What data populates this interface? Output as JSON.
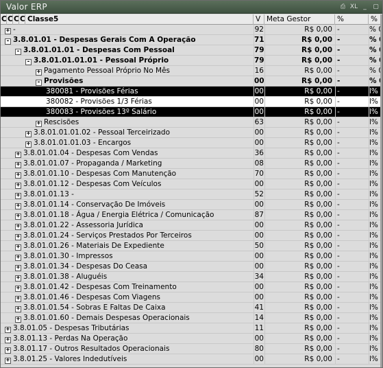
{
  "window": {
    "title": "Valor ERP",
    "buttons": [
      "⎙",
      "XL",
      "_",
      "▢"
    ]
  },
  "headers": {
    "cl1": "Cl",
    "cl2": "Cl",
    "cl3": "Cl",
    "cl4": "Cl",
    "classe5": "Classe5",
    "v": "V",
    "meta": "Meta Gestor",
    "p1": "%",
    "p2": "%"
  },
  "rows": [
    {
      "level": 0,
      "exp": "+",
      "label": "-",
      "v": "92",
      "meta": "R$ 0,00",
      "p1": "-",
      "p2": "% 0",
      "style": ""
    },
    {
      "level": 0,
      "exp": "-",
      "label": "3.8.01.01 - Despesas Gerais Com A Operação",
      "v": "71",
      "meta": "R$ 0,00",
      "p1": "-",
      "p2": "% 0",
      "style": "bold"
    },
    {
      "level": 1,
      "exp": "-",
      "label": "3.8.01.01.01 - Despesas Com Pessoal",
      "v": "79",
      "meta": "R$ 0,00",
      "p1": "-",
      "p2": "% 0",
      "style": "bold"
    },
    {
      "level": 2,
      "exp": "-",
      "label": "3.8.01.01.01.01 - Pessoal Próprio",
      "v": "79",
      "meta": "R$ 0,00",
      "p1": "-",
      "p2": "% 0",
      "style": "bold"
    },
    {
      "level": 3,
      "exp": "+",
      "label": "Pagamento Pessoal Próprio No Mês",
      "v": "16",
      "meta": "R$ 0,00",
      "p1": "-",
      "p2": "% 0",
      "style": ""
    },
    {
      "level": 3,
      "exp": "-",
      "label": "Provisões",
      "v": "00",
      "meta": "R$ 0,00",
      "p1": "-",
      "p2": "% 0",
      "style": "bold"
    },
    {
      "level": 4,
      "exp": "",
      "label": "380081 - Provisões Férias",
      "v": "00",
      "meta": "R$ 0,00",
      "p1": "-",
      "p2": "l% 0",
      "style": "sel"
    },
    {
      "level": 4,
      "exp": "",
      "label": "380082 - Provisões  1/3  Férias",
      "v": "00",
      "meta": "R$ 0,00",
      "p1": "-",
      "p2": "l% 0",
      "style": "selpart"
    },
    {
      "level": 4,
      "exp": "",
      "label": "380083 - Provisões 13º Salário",
      "v": "00",
      "meta": "R$ 0,00",
      "p1": "-",
      "p2": "l% 0",
      "style": "sel"
    },
    {
      "level": 3,
      "exp": "+",
      "label": "Rescisões",
      "v": "63",
      "meta": "R$ 0,00",
      "p1": "-",
      "p2": "l% 0",
      "style": ""
    },
    {
      "level": 2,
      "exp": "+",
      "label": "3.8.01.01.01.02 - Pessoal Terceirizado",
      "v": "00",
      "meta": "R$ 0,00",
      "p1": "-",
      "p2": "l% 0",
      "style": ""
    },
    {
      "level": 2,
      "exp": "+",
      "label": "3.8.01.01.01.03 - Encargos",
      "v": "00",
      "meta": "R$ 0,00",
      "p1": "-",
      "p2": "l% 0",
      "style": ""
    },
    {
      "level": 1,
      "exp": "+",
      "label": "3.8.01.01.04 - Despesas Com Vendas",
      "v": "36",
      "meta": "R$ 0,00",
      "p1": "-",
      "p2": "l% 0",
      "style": ""
    },
    {
      "level": 1,
      "exp": "+",
      "label": "3.8.01.01.07 - Propaganda / Marketing",
      "v": "08",
      "meta": "R$ 0,00",
      "p1": "-",
      "p2": "l% 0",
      "style": ""
    },
    {
      "level": 1,
      "exp": "+",
      "label": "3.8.01.01.10 - Despesas Com Manutenção",
      "v": "70",
      "meta": "R$ 0,00",
      "p1": "-",
      "p2": "l% 0",
      "style": ""
    },
    {
      "level": 1,
      "exp": "+",
      "label": "3.8.01.01.12 - Despesas Com Veículos",
      "v": "00",
      "meta": "R$ 0,00",
      "p1": "-",
      "p2": "l% 0",
      "style": ""
    },
    {
      "level": 1,
      "exp": "+",
      "label": "3.8.01.01.13 -",
      "v": "52",
      "meta": "R$ 0,00",
      "p1": "-",
      "p2": "l% 0",
      "style": ""
    },
    {
      "level": 1,
      "exp": "+",
      "label": "3.8.01.01.14 - Conservação De Imóveis",
      "v": "00",
      "meta": "R$ 0,00",
      "p1": "-",
      "p2": "l% 0",
      "style": ""
    },
    {
      "level": 1,
      "exp": "+",
      "label": "3.8.01.01.18 - Água / Energia Elétrica / Comunicação",
      "v": "87",
      "meta": "R$ 0,00",
      "p1": "-",
      "p2": "l% 0",
      "style": ""
    },
    {
      "level": 1,
      "exp": "+",
      "label": "3.8.01.01.22 - Assessoria Jurídica",
      "v": "00",
      "meta": "R$ 0,00",
      "p1": "-",
      "p2": "l% 0",
      "style": ""
    },
    {
      "level": 1,
      "exp": "+",
      "label": "3.8.01.01.24 - Serviços Prestados Por Terceiros",
      "v": "00",
      "meta": "R$ 0,00",
      "p1": "-",
      "p2": "l% 0",
      "style": ""
    },
    {
      "level": 1,
      "exp": "+",
      "label": "3.8.01.01.26 - Materiais De Expediente",
      "v": "50",
      "meta": "R$ 0,00",
      "p1": "-",
      "p2": "l% 0",
      "style": ""
    },
    {
      "level": 1,
      "exp": "+",
      "label": "3.8.01.01.30 - Impressos",
      "v": "00",
      "meta": "R$ 0,00",
      "p1": "-",
      "p2": "l% 0",
      "style": ""
    },
    {
      "level": 1,
      "exp": "+",
      "label": "3.8.01.01.34 - Despesas Do Ceasa",
      "v": "00",
      "meta": "R$ 0,00",
      "p1": "-",
      "p2": "l% 0",
      "style": ""
    },
    {
      "level": 1,
      "exp": "+",
      "label": "3.8.01.01.38 - Aluguéis",
      "v": "34",
      "meta": "R$ 0,00",
      "p1": "-",
      "p2": "l% 0",
      "style": ""
    },
    {
      "level": 1,
      "exp": "+",
      "label": "3.8.01.01.42 - Despesas Com Treinamento",
      "v": "00",
      "meta": "R$ 0,00",
      "p1": "-",
      "p2": "l% 0",
      "style": ""
    },
    {
      "level": 1,
      "exp": "+",
      "label": "3.8.01.01.46 - Despesas Com Viagens",
      "v": "00",
      "meta": "R$ 0,00",
      "p1": "-",
      "p2": "l% 0",
      "style": ""
    },
    {
      "level": 1,
      "exp": "+",
      "label": "3.8.01.01.54 - Sobras E Faltas De Caixa",
      "v": "41",
      "meta": "R$ 0,00",
      "p1": "-",
      "p2": "l% 0",
      "style": ""
    },
    {
      "level": 1,
      "exp": "+",
      "label": "3.8.01.01.60 - Demais Despesas Operacionais",
      "v": "14",
      "meta": "R$ 0,00",
      "p1": "-",
      "p2": "l% 0",
      "style": ""
    },
    {
      "level": 0,
      "exp": "+",
      "label": "3.8.01.05 - Despesas Tributárias",
      "v": "11",
      "meta": "R$ 0,00",
      "p1": "-",
      "p2": "l% 0",
      "style": ""
    },
    {
      "level": 0,
      "exp": "+",
      "label": "3.8.01.13 - Perdas Na Operação",
      "v": "00",
      "meta": "R$ 0,00",
      "p1": "-",
      "p2": "l% 0",
      "style": ""
    },
    {
      "level": 0,
      "exp": "+",
      "label": "3.8.01.17 - Outros Resultados Operacionais",
      "v": "80",
      "meta": "R$ 0,00",
      "p1": "-",
      "p2": "l% 0",
      "style": ""
    },
    {
      "level": 0,
      "exp": "+",
      "label": "3.8.01.25 - Valores Indedutíveis",
      "v": "00",
      "meta": "R$ 0,00",
      "p1": "-",
      "p2": "l% 0",
      "style": ""
    }
  ]
}
